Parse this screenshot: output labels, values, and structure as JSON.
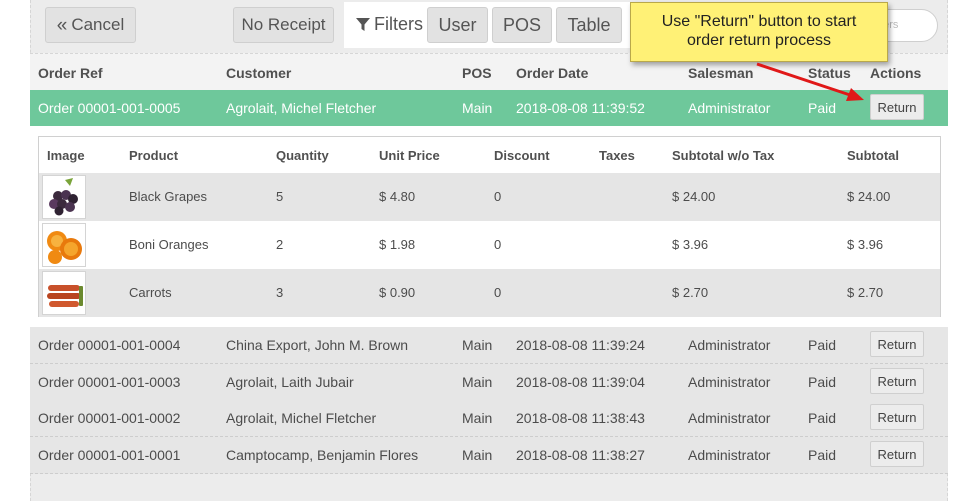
{
  "toolbar": {
    "cancel_label": "Cancel",
    "no_receipt_label": "No Receipt",
    "filters_label": "Filters",
    "filter_buttons": [
      "User",
      "POS",
      "Table"
    ],
    "search_placeholder": "ders"
  },
  "callout": {
    "line1": "Use \"Return\" button to start",
    "line2": "order return process"
  },
  "orders": {
    "headers": [
      "Order Ref",
      "Customer",
      "POS",
      "Order Date",
      "Salesman",
      "Status",
      "Actions"
    ],
    "return_label": "Return",
    "rows": [
      {
        "ref": "Order 00001-001-0005",
        "customer": "Agrolait, Michel Fletcher",
        "pos": "Main",
        "date": "2018-08-08 11:39:52",
        "salesman": "Administrator",
        "status": "Paid"
      },
      {
        "ref": "Order 00001-001-0004",
        "customer": "China Export, John M. Brown",
        "pos": "Main",
        "date": "2018-08-08 11:39:24",
        "salesman": "Administrator",
        "status": "Paid"
      },
      {
        "ref": "Order 00001-001-0003",
        "customer": "Agrolait, Laith Jubair",
        "pos": "Main",
        "date": "2018-08-08 11:39:04",
        "salesman": "Administrator",
        "status": "Paid"
      },
      {
        "ref": "Order 00001-001-0002",
        "customer": "Agrolait, Michel Fletcher",
        "pos": "Main",
        "date": "2018-08-08 11:38:43",
        "salesman": "Administrator",
        "status": "Paid"
      },
      {
        "ref": "Order 00001-001-0001",
        "customer": "Camptocamp, Benjamin Flores",
        "pos": "Main",
        "date": "2018-08-08 11:38:27",
        "salesman": "Administrator",
        "status": "Paid"
      }
    ]
  },
  "details": {
    "headers": [
      "Image",
      "Product",
      "Quantity",
      "Unit Price",
      "Discount",
      "Taxes",
      "Subtotal w/o Tax",
      "Subtotal"
    ],
    "lines": [
      {
        "image": "grapes-image",
        "product": "Black Grapes",
        "qty": "5",
        "unit_price": "$ 4.80",
        "discount": "0",
        "taxes": "",
        "subtotal_wo_tax": "$ 24.00",
        "subtotal": "$ 24.00"
      },
      {
        "image": "oranges-image",
        "product": "Boni Oranges",
        "qty": "2",
        "unit_price": "$ 1.98",
        "discount": "0",
        "taxes": "",
        "subtotal_wo_tax": "$ 3.96",
        "subtotal": "$ 3.96"
      },
      {
        "image": "carrots-image",
        "product": "Carrots",
        "qty": "3",
        "unit_price": "$ 0.90",
        "discount": "0",
        "taxes": "",
        "subtotal_wo_tax": "$ 2.70",
        "subtotal": "$ 2.70"
      }
    ]
  },
  "colors": {
    "selected_row": "#6ec89b",
    "callout_bg": "#fff176",
    "arrow": "#e01818"
  }
}
